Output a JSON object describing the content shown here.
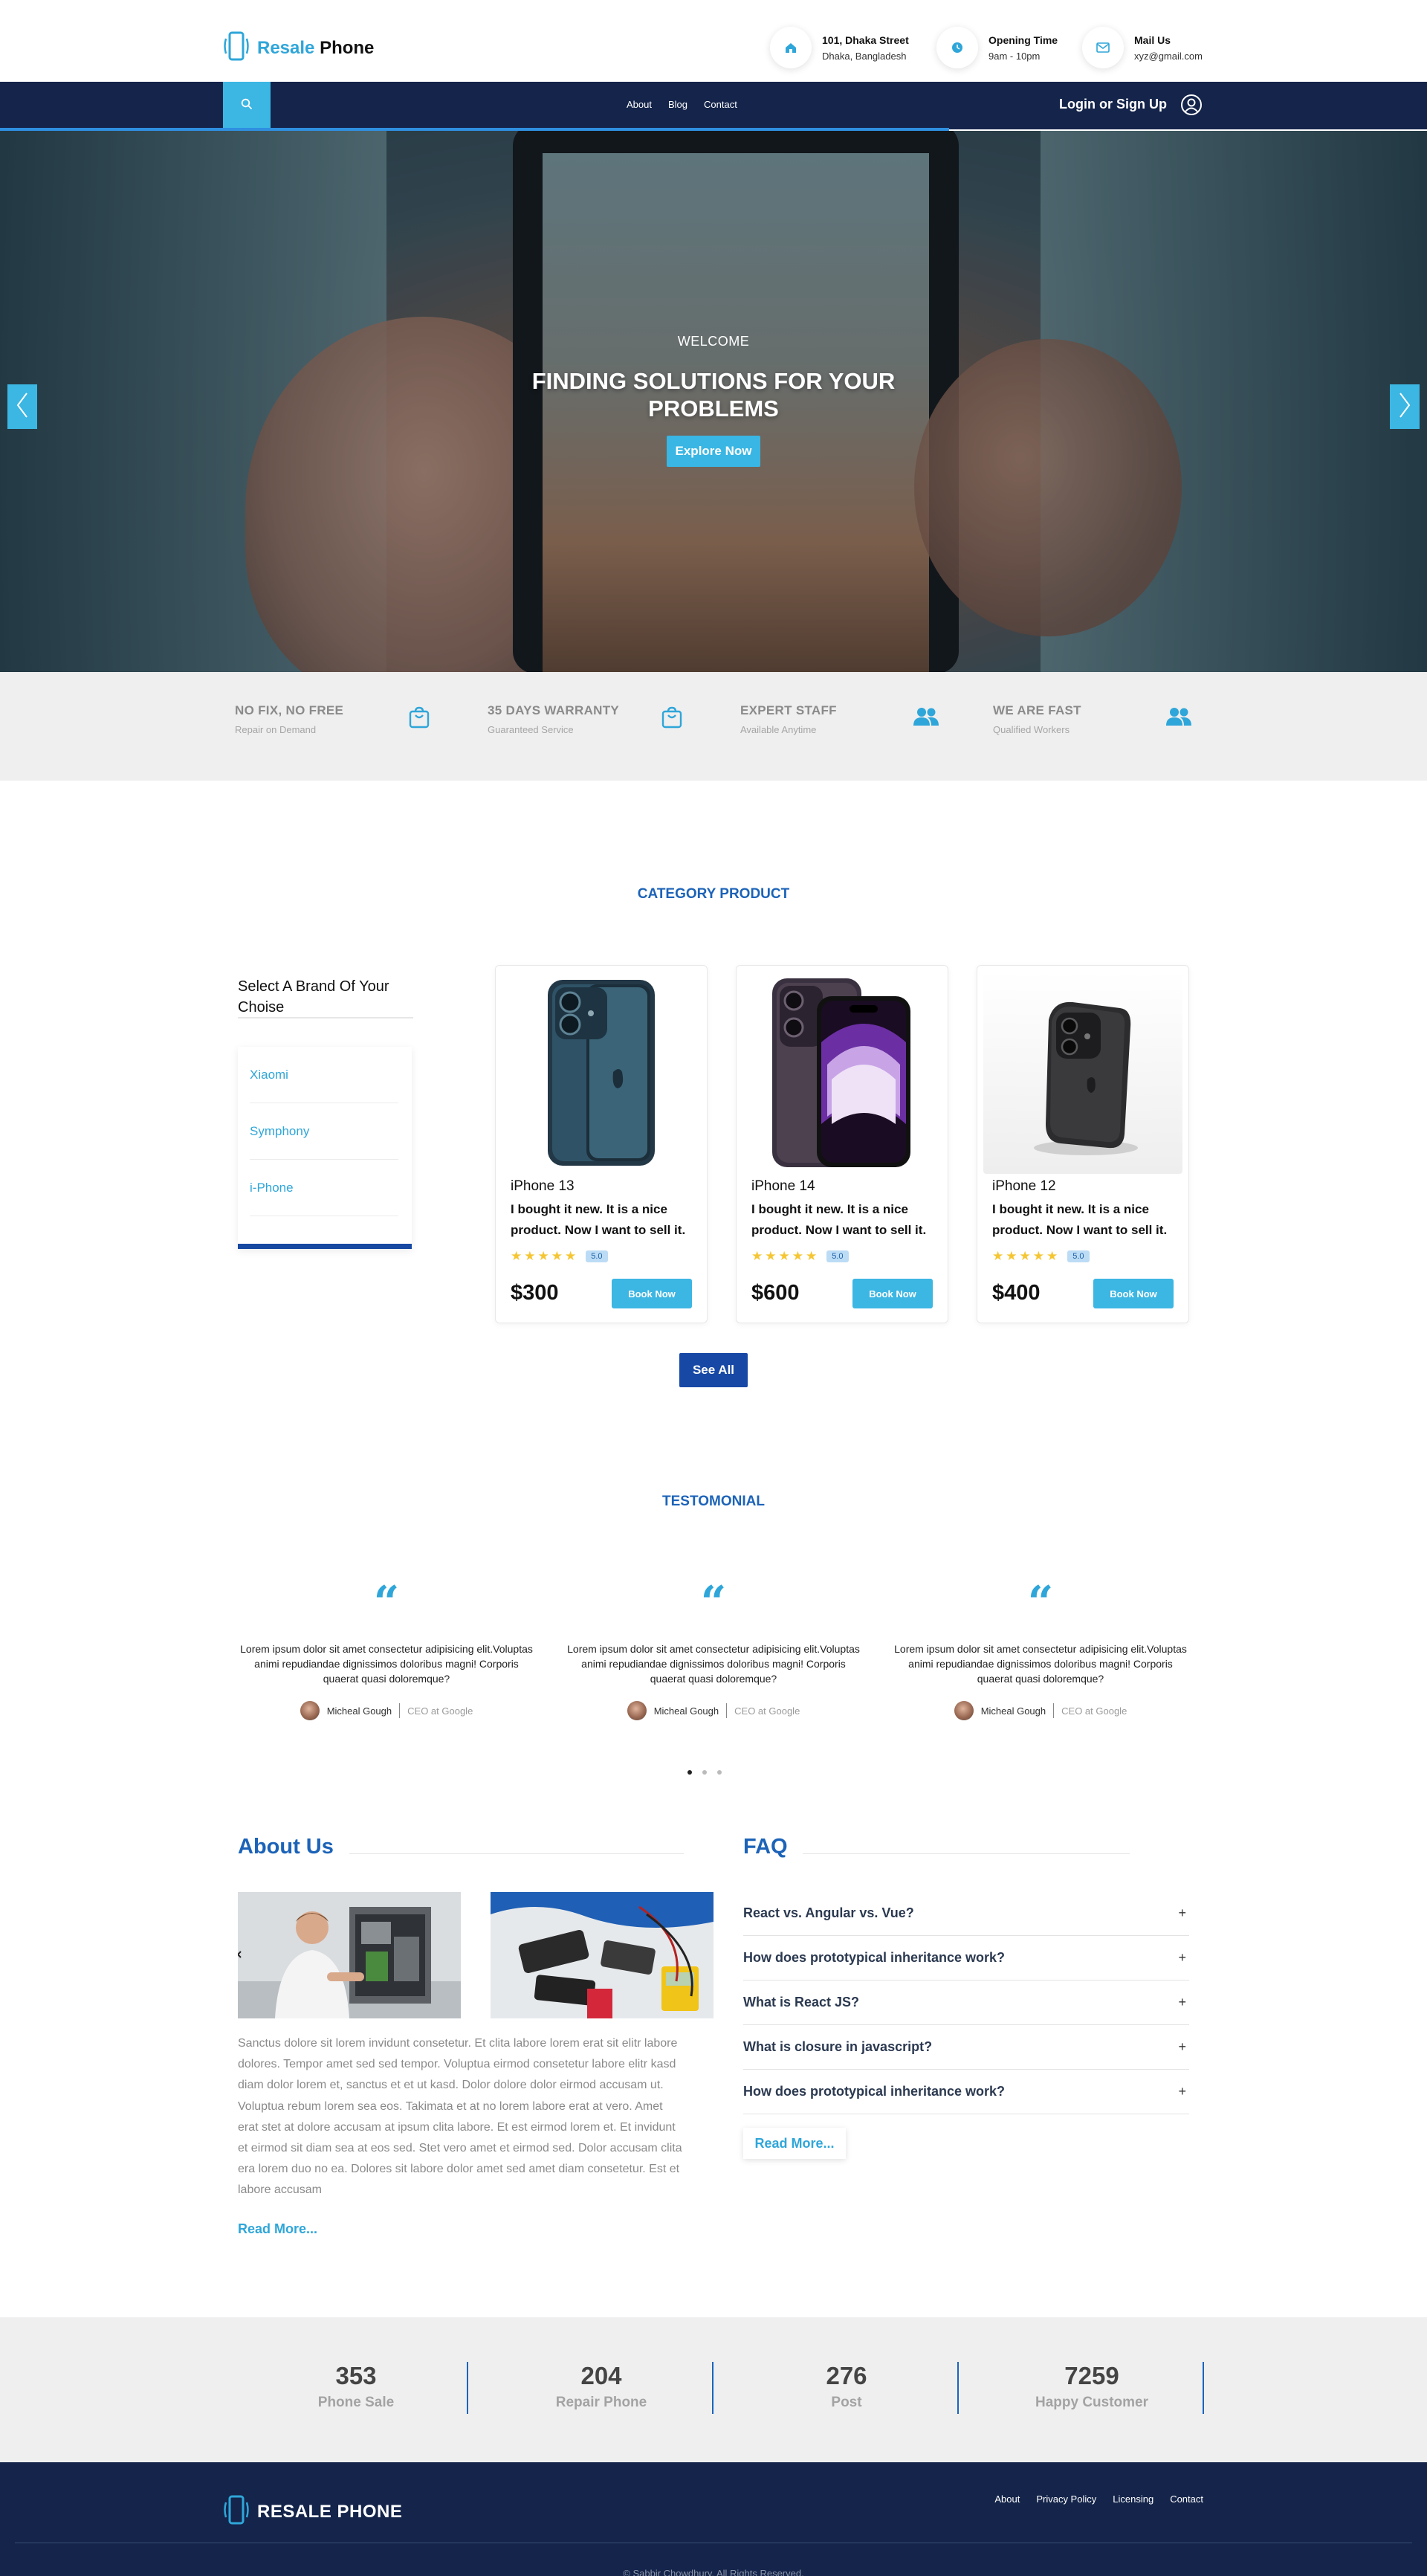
{
  "header": {
    "logo_brand": "Resale",
    "logo_word": "Phone",
    "address_title": "101, Dhaka Street",
    "address_sub": "Dhaka, Bangladesh",
    "hours_title": "Opening Time",
    "hours_sub": "9am - 10pm",
    "mail_title": "Mail Us",
    "mail_sub": "xyz@gmail.com"
  },
  "nav": {
    "links": [
      "About",
      "Blog",
      "Contact"
    ],
    "login": "Login or Sign Up"
  },
  "hero": {
    "welcome": "WELCOME",
    "title": "FINDING SOLUTIONS FOR YOUR PROBLEMS",
    "button": "Explore Now"
  },
  "features": [
    {
      "title": "NO FIX, NO FREE",
      "sub": "Repair on Demand",
      "icon": "shopping-bag-icon"
    },
    {
      "title": "35 DAYS WARRANTY",
      "sub": "Guaranteed Service",
      "icon": "shopping-bag-icon"
    },
    {
      "title": "EXPERT STAFF",
      "sub": "Available Anytime",
      "icon": "users-icon"
    },
    {
      "title": "WE ARE FAST",
      "sub": "Qualified Workers",
      "icon": "users-icon"
    }
  ],
  "category": {
    "title": "CATEGORY PRODUCT",
    "brand_heading": "Select A Brand Of Your Choise",
    "brands": [
      "Xiaomi",
      "Symphony",
      "i-Phone"
    ],
    "products": [
      {
        "name": "iPhone 13",
        "desc": "I bought it new. It is a nice product. Now I want to sell it.",
        "rating": "5.0",
        "price": "$300",
        "button": "Book Now"
      },
      {
        "name": "iPhone 14",
        "desc": "I bought it new. It is a nice product. Now I want to sell it.",
        "rating": "5.0",
        "price": "$600",
        "button": "Book Now"
      },
      {
        "name": "iPhone 12",
        "desc": "I bought it new. It is a nice product. Now I want to sell it.",
        "rating": "5.0",
        "price": "$400",
        "button": "Book Now"
      }
    ],
    "see_all": "See All"
  },
  "testimonial": {
    "title": "TESTOMONIAL",
    "quote_mark": "“",
    "items": [
      {
        "text": "Lorem ipsum dolor sit amet consectetur adipisicing elit.Voluptas animi repudiandae dignissimos doloribus magni! Corporis quaerat quasi doloremque?",
        "name": "Micheal Gough",
        "role": "CEO at Google"
      },
      {
        "text": "Lorem ipsum dolor sit amet consectetur adipisicing elit.Voluptas animi repudiandae dignissimos doloribus magni! Corporis quaerat quasi doloremque?",
        "name": "Micheal Gough",
        "role": "CEO at Google"
      },
      {
        "text": "Lorem ipsum dolor sit amet consectetur adipisicing elit.Voluptas animi repudiandae dignissimos doloribus magni! Corporis quaerat quasi doloremque?",
        "name": "Micheal Gough",
        "role": "CEO at Google"
      }
    ]
  },
  "about": {
    "title": "About Us",
    "text": "Sanctus dolore sit lorem invidunt consetetur. Et clita labore lorem erat sit elitr labore dolores. Tempor amet sed sed tempor. Voluptua eirmod consetetur labore elitr kasd diam dolor lorem et, sanctus et et ut kasd. Dolor dolore dolor eirmod accusam ut. Voluptua rebum lorem sea eos. Takimata et at no lorem labore erat at vero. Amet erat stet at dolore accusam at ipsum clita labore. Et est eirmod lorem et. Et invidunt et eirmod sit diam sea at eos sed. Stet vero amet et eirmod sed. Dolor accusam clita era lorem duo no ea. Dolores sit labore dolor amet sed amet diam consetetur. Est et labore accusam",
    "read_more": "Read More..."
  },
  "faq": {
    "title": "FAQ",
    "items": [
      "React vs. Angular vs. Vue?",
      "How does prototypical inheritance work?",
      "What is React JS?",
      "What is closure in javascript?",
      "How does prototypical inheritance work?"
    ],
    "plus": "+",
    "read_more": "Read More..."
  },
  "stats": [
    {
      "number": "353",
      "label": "Phone Sale"
    },
    {
      "number": "204",
      "label": "Repair Phone"
    },
    {
      "number": "276",
      "label": "Post"
    },
    {
      "number": "7259",
      "label": "Happy Customer"
    }
  ],
  "footer": {
    "logo": "RESALE PHONE",
    "links": [
      "About",
      "Privacy Policy",
      "Licensing",
      "Contact"
    ],
    "copyright": "© Sabbir Chowdhury. All Rights Reserved."
  },
  "colors": {
    "accent": "#3cb6e3",
    "brand_blue": "#1c63b8",
    "navy": "#14244a",
    "dark_button": "#1748a5",
    "star": "#f5c633"
  }
}
